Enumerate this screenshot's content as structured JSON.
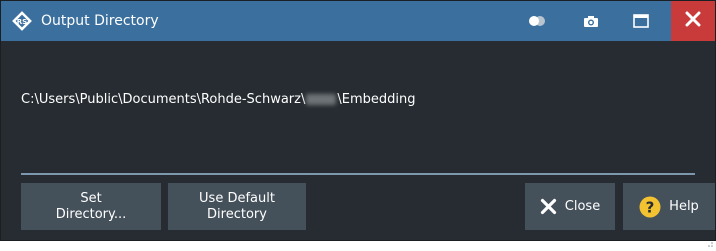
{
  "window": {
    "title": "Output Directory",
    "colors": {
      "titlebar": "#3a6f9e",
      "body": "#262c31",
      "button": "#44505a",
      "close_button": "#c93a3a",
      "help_icon": "#f2c230",
      "divider": "#7d97ad"
    }
  },
  "titlebar_icons": {
    "logo": "rohde-schwarz-logo-icon",
    "toggle": "toggle-icon",
    "camera": "camera-icon",
    "maximize": "maximize-icon",
    "close": "close-icon"
  },
  "path": {
    "prefix": "C:\\Users\\Public\\Documents\\Rohde-Schwarz\\",
    "suffix": "\\Embedding"
  },
  "buttons": {
    "set_directory_line1": "Set",
    "set_directory_line2": "Directory...",
    "use_default_line1": "Use Default",
    "use_default_line2": "Directory",
    "close": "Close",
    "help": "Help"
  }
}
